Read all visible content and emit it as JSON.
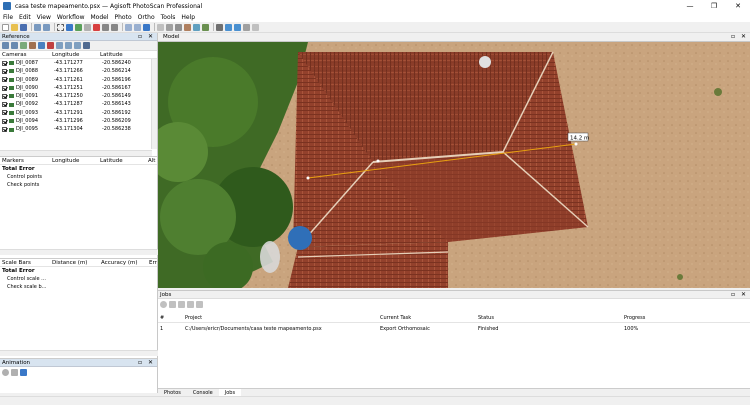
{
  "window": {
    "title": "casa teste mapeamento.psx — Agisoft PhotoScan Professional",
    "controls": [
      "—",
      "❐",
      "✕"
    ]
  },
  "menu": [
    "File",
    "Edit",
    "View",
    "Workflow",
    "Model",
    "Photo",
    "Ortho",
    "Tools",
    "Help"
  ],
  "reference": {
    "panel_title": "Reference",
    "cameras_header": {
      "name": "Cameras",
      "longitude": "Longitude",
      "latitude": "Latitude"
    },
    "cameras": [
      {
        "name": "DJI_0087",
        "longitude": "-43.171277",
        "latitude": "-20.586240"
      },
      {
        "name": "DJI_0088",
        "longitude": "-43.171266",
        "latitude": "-20.586214"
      },
      {
        "name": "DJI_0089",
        "longitude": "-43.171261",
        "latitude": "-20.586196"
      },
      {
        "name": "DJI_0090",
        "longitude": "-43.171251",
        "latitude": "-20.586167"
      },
      {
        "name": "DJI_0091",
        "longitude": "-43.171250",
        "latitude": "-20.586149"
      },
      {
        "name": "DJI_0092",
        "longitude": "-43.171287",
        "latitude": "-20.586143"
      },
      {
        "name": "DJI_0093",
        "longitude": "-43.171291",
        "latitude": "-20.586192"
      },
      {
        "name": "DJI_0094",
        "longitude": "-43.171296",
        "latitude": "-20.586209"
      },
      {
        "name": "DJI_0095",
        "longitude": "-43.171304",
        "latitude": "-20.586238"
      }
    ],
    "markers_header": {
      "name": "Markers",
      "longitude": "Longitude",
      "latitude": "Latitude",
      "alt": "Alt"
    },
    "markers_total": "Total Error",
    "markers_items": [
      "Control points",
      "Check points"
    ],
    "scalebars_header": {
      "name": "Scale Bars",
      "distance": "Distance (m)",
      "accuracy": "Accuracy (m)",
      "error": "Err"
    },
    "scalebars_total": "Total Error",
    "scalebars_items": [
      "Control scale ...",
      "Check scale b..."
    ]
  },
  "animation": {
    "panel_title": "Animation"
  },
  "model": {
    "tab": "Model",
    "measure_label": "14.2 m"
  },
  "jobs": {
    "panel_title": "Jobs",
    "headers": {
      "num": "#",
      "project": "Project",
      "task": "Current Task",
      "status": "Status",
      "progress": "Progress"
    },
    "rows": [
      {
        "num": "1",
        "project": "C:/Users/ericr/Documents/casa teste mapeamento.psx",
        "task": "Export Orthomosaic",
        "status": "Finished",
        "progress": "100%"
      }
    ]
  },
  "bottom_tabs": [
    "Photos",
    "Console",
    "Jobs"
  ],
  "colors": {
    "panel_header": "#d8e4f0",
    "roof": "#8f3f2b",
    "soil": "#c9a47e",
    "vegetation": "#4a7a2a",
    "pool": "#2f6fb8",
    "measure_line": "#e8a010"
  }
}
